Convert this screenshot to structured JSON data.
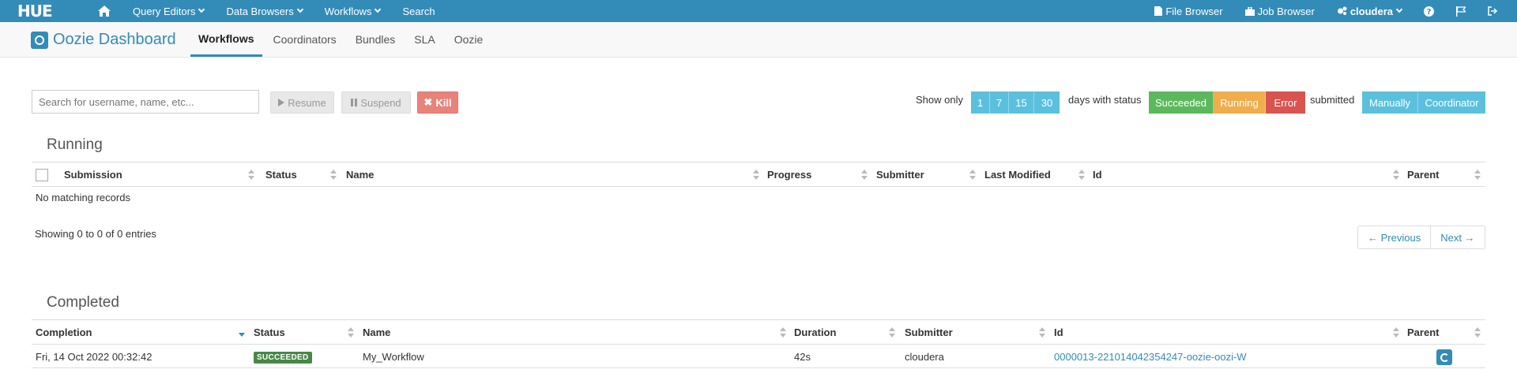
{
  "topnav": {
    "logo": "HUE",
    "menu": [
      {
        "label": "Query Editors"
      },
      {
        "label": "Data Browsers"
      },
      {
        "label": "Workflows"
      },
      {
        "label": "Search"
      }
    ],
    "right": {
      "file_browser": "File Browser",
      "job_browser": "Job Browser",
      "user": "cloudera"
    }
  },
  "subnav": {
    "title": "Oozie Dashboard",
    "tabs": [
      "Workflows",
      "Coordinators",
      "Bundles",
      "SLA",
      "Oozie"
    ],
    "active_tab": "Workflows"
  },
  "toolbar": {
    "search_placeholder": "Search for username, name, etc...",
    "resume": "Resume",
    "suspend": "Suspend",
    "kill": "Kill",
    "show_only": "Show only",
    "days": [
      "1",
      "7",
      "15",
      "30"
    ],
    "days_with_status": "days with status",
    "statuses": [
      "Succeeded",
      "Running",
      "Error"
    ],
    "submitted": "submitted",
    "submitted_by": [
      "Manually",
      "Coordinator"
    ]
  },
  "running": {
    "title": "Running",
    "columns": [
      "Submission",
      "Status",
      "Name",
      "Progress",
      "Submitter",
      "Last Modified",
      "Id",
      "Parent"
    ],
    "empty": "No matching records",
    "info": "Showing 0 to 0 of 0 entries",
    "prev": "← Previous",
    "next": "Next →"
  },
  "completed": {
    "title": "Completed",
    "columns": [
      "Completion",
      "Status",
      "Name",
      "Duration",
      "Submitter",
      "Id",
      "Parent"
    ],
    "rows": [
      {
        "completion": "Fri, 14 Oct 2022 00:32:42",
        "status": "SUCCEEDED",
        "name": "My_Workflow",
        "duration": "42s",
        "submitter": "cloudera",
        "id": "0000013-221014042354247-oozie-oozi-W"
      }
    ]
  },
  "colors": {
    "primary": "#338bb8",
    "success": "#5cb85c",
    "warning": "#f0ad4e",
    "danger": "#d9534f",
    "info": "#5bc0de"
  }
}
